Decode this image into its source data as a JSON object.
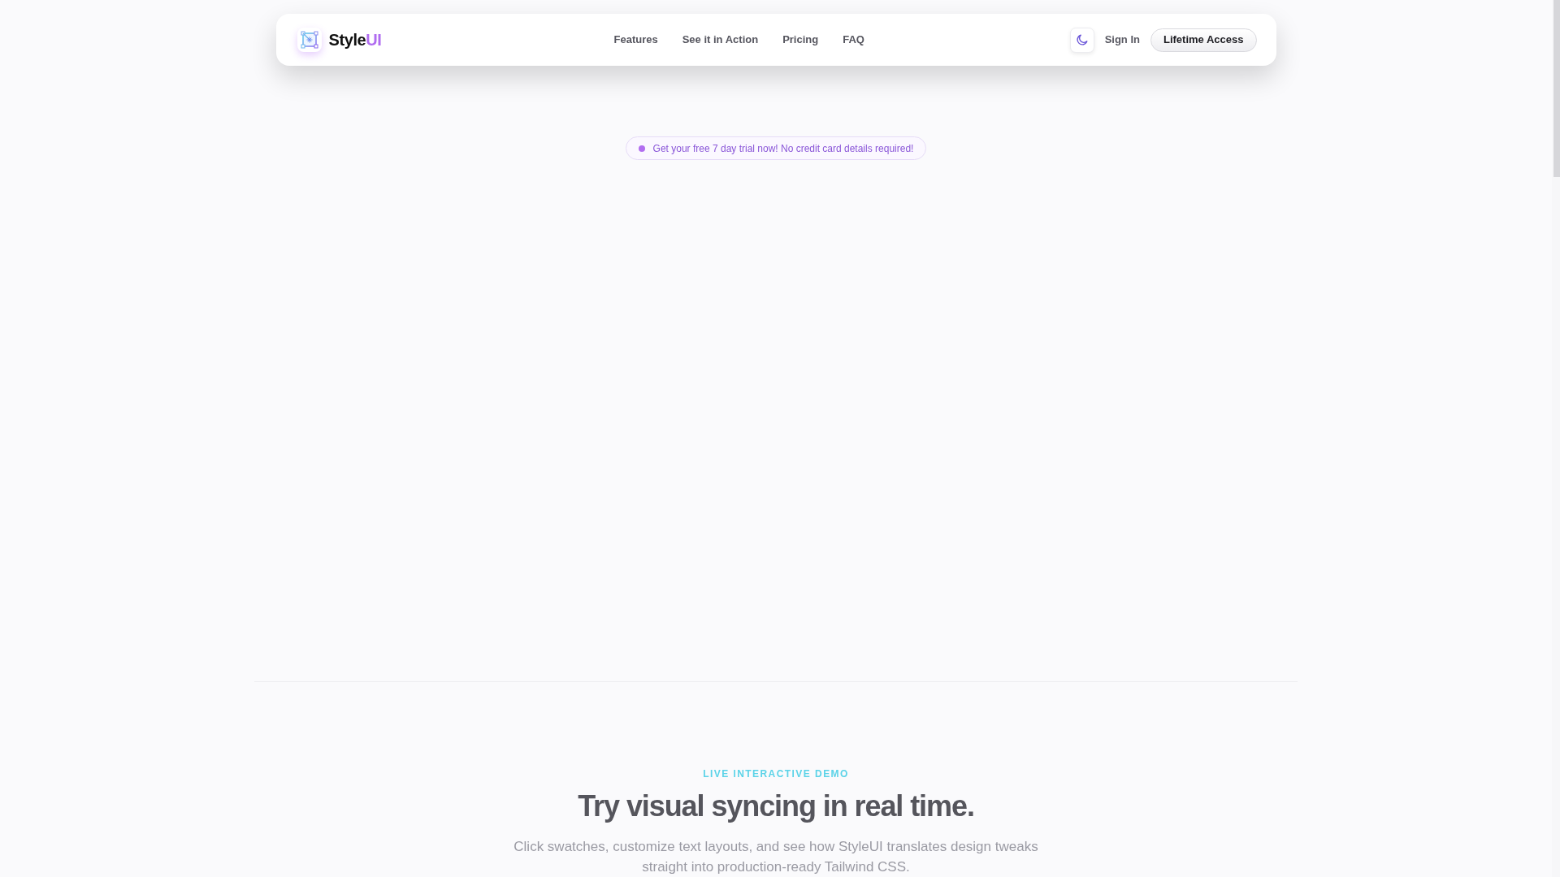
{
  "navbar": {
    "brand": {
      "name": "Style",
      "name_accent": "UI"
    },
    "links": [
      "Features",
      "See it in Action",
      "Pricing",
      "FAQ"
    ],
    "sign_in": "Sign In",
    "cta": "Lifetime Access"
  },
  "announcement": {
    "text": "Get your free 7 day trial now! No credit card details required!"
  },
  "demo_section": {
    "eyebrow": "LIVE INTERACTIVE DEMO",
    "title": "Try visual syncing in real time.",
    "description": "Click swatches, customize text layouts, and see how StyleUI translates design tweaks straight into production-ready Tailwind CSS."
  }
}
